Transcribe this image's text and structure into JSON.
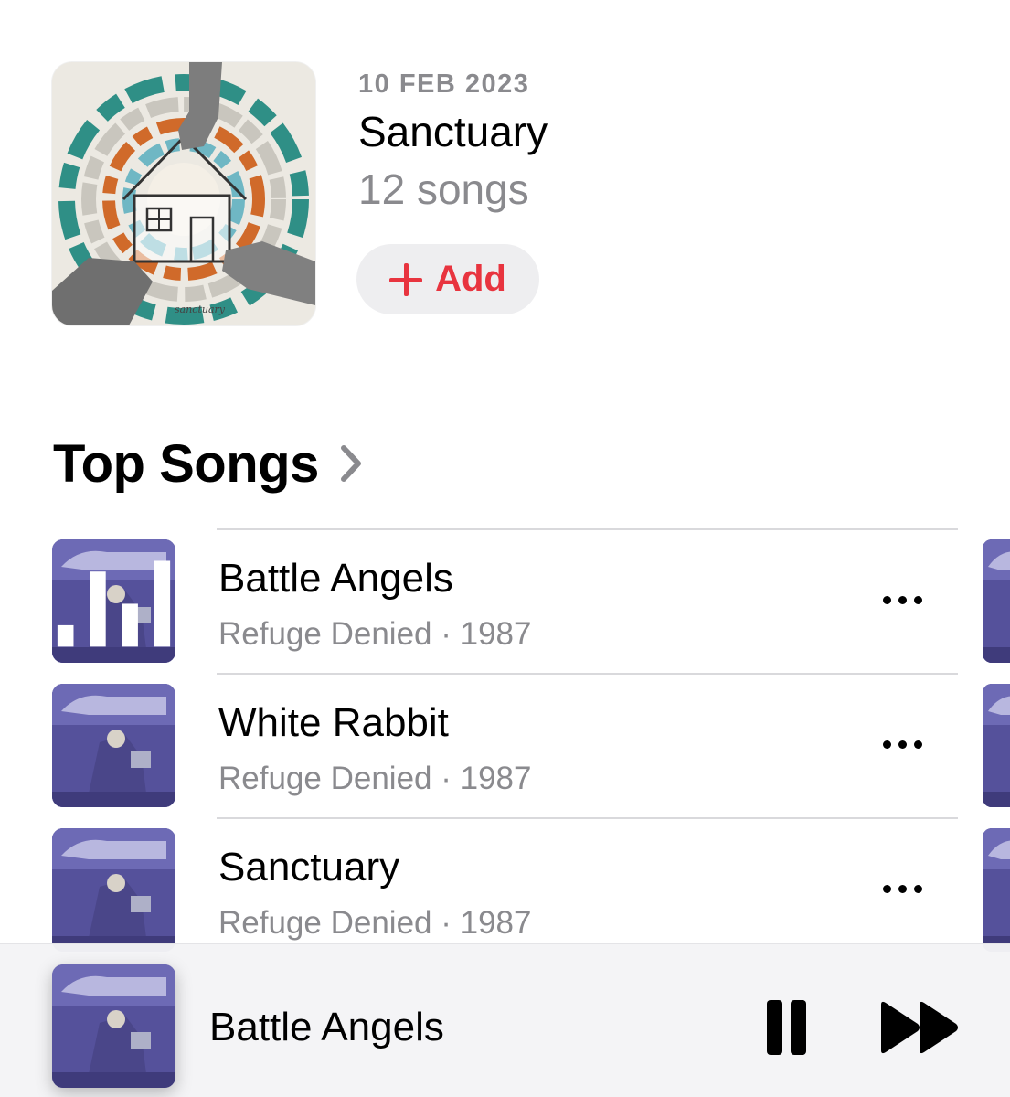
{
  "release": {
    "date": "10 FEB 2023",
    "title": "Sanctuary",
    "song_count": "12 songs",
    "add_label": "Add",
    "artwork_icon": "album-art-sanctuary"
  },
  "top_songs": {
    "title": "Top Songs",
    "songs": [
      {
        "title": "Battle Angels",
        "subtitle": "Refuge Denied · 1987",
        "now_playing": true
      },
      {
        "title": "White Rabbit",
        "subtitle": "Refuge Denied · 1987",
        "now_playing": false
      },
      {
        "title": "Sanctuary",
        "subtitle": "Refuge Denied · 1987",
        "now_playing": false
      }
    ]
  },
  "mini_player": {
    "title": "Battle Angels",
    "state": "playing"
  },
  "colors": {
    "accent": "#e8343f",
    "secondary_text": "#8a8a8e",
    "button_bg": "#eeeef0",
    "divider": "#d9d9dc"
  }
}
